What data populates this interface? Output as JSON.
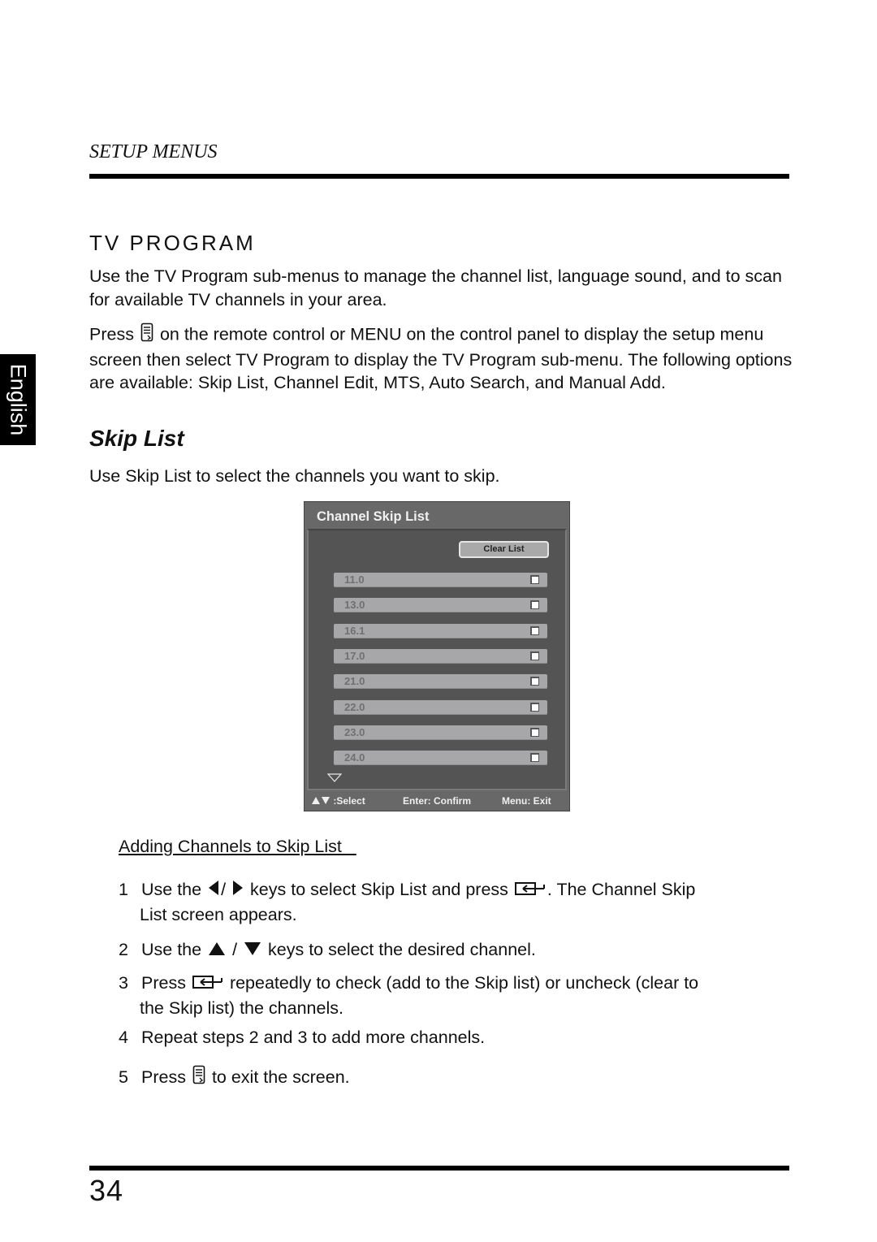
{
  "header": {
    "section": "SETUP MENUS"
  },
  "side_tab": {
    "language": "English"
  },
  "content": {
    "heading": "TV PROGRAM",
    "intro": "Use the TV Program sub-menus to manage the channel list, language sound, and to scan for available TV channels in your area.",
    "press_para": {
      "before_icon": "Press",
      "after_icon": "on the remote control or MENU on the control panel to display the setup menu screen then select TV Program  to display the TV Program sub-menu. The following options are available: Skip List, Channel Edit, MTS, Auto Search, and Manual Add."
    },
    "subheading": "Skip List",
    "skip_intro": "Use Skip List to select the channels you want to skip."
  },
  "dialog": {
    "title": "Channel Skip List",
    "clear_button": "Clear List",
    "channels": [
      {
        "number": "11.0",
        "checked": false
      },
      {
        "number": "13.0",
        "checked": false
      },
      {
        "number": "16.1",
        "checked": false
      },
      {
        "number": "17.0",
        "checked": false
      },
      {
        "number": "21.0",
        "checked": false
      },
      {
        "number": "22.0",
        "checked": false
      },
      {
        "number": "23.0",
        "checked": false
      },
      {
        "number": "24.0",
        "checked": false
      }
    ],
    "footer": {
      "select": ":Select",
      "confirm": "Enter: Confirm",
      "exit": "Menu: Exit"
    },
    "colors": {
      "frame": "#686868",
      "panel": "#545454",
      "row": "#a7a7a9"
    }
  },
  "instructions": {
    "heading": "Adding Channels to Skip List   ",
    "steps": [
      {
        "num": "1",
        "a": "Use the",
        "sep": "/",
        "b": "keys to select Skip List  and press",
        "c": ". The Channel Skip",
        "d": "List screen appears."
      },
      {
        "num": "2",
        "a": "Use the",
        "sep": "/",
        "b": "keys to select the desired channel."
      },
      {
        "num": "3",
        "a": "Press",
        "b": "repeatedly to check (add to the Skip list) or uncheck (clear to",
        "d": "the Skip list) the channels."
      },
      {
        "num": "4",
        "a": "Repeat steps 2 and 3 to add more channels."
      },
      {
        "num": "5",
        "a": "Press",
        "b": "to exit the screen."
      }
    ]
  },
  "footer": {
    "page_number": "34"
  }
}
